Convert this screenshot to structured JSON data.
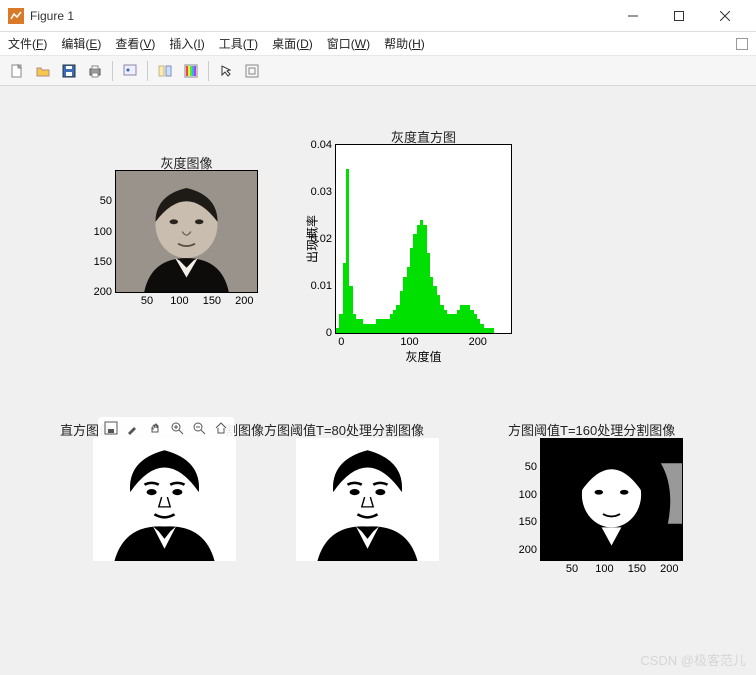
{
  "window": {
    "title": "Figure 1",
    "min_name": "minimize-icon",
    "max_name": "maximize-icon",
    "close_name": "close-icon"
  },
  "menu": {
    "file": "文件(F)",
    "edit": "编辑(E)",
    "view": "查看(V)",
    "insert": "插入(I)",
    "tools": "工具(T)",
    "desktop": "桌面(D)",
    "window": "窗口(W)",
    "help": "帮助(H)"
  },
  "toolbar": {
    "new": "new",
    "open": "open",
    "save": "save",
    "print": "print",
    "datacursor": "data-cursor",
    "link": "link",
    "colorbar": "colorbar",
    "legend": "legend",
    "arrow": "arrow",
    "editplot": "edit-plot"
  },
  "floating": {
    "save": "save",
    "brush": "brush",
    "hand": "hand",
    "zoomin": "zoom-in",
    "zoomout": "zoom-out",
    "home": "home"
  },
  "subplots": {
    "gray": {
      "title": "灰度图像",
      "yticks": [
        "50",
        "100",
        "150",
        "200"
      ],
      "xticks": [
        "50",
        "100",
        "150",
        "200"
      ]
    },
    "hist": {
      "title": "灰度直方图",
      "ylabel": "出现概率",
      "xlabel": "灰度值",
      "yticks": [
        "0",
        "0.01",
        "0.02",
        "0.03",
        "0.04"
      ],
      "xticks": [
        "0",
        "100",
        "200"
      ]
    },
    "row2": {
      "t1": "直方图像",
      "t2": "割图像方图阈值T=80处理分割图像",
      "t3": "方图阈值T=160处理分割图像",
      "yticks": [
        "50",
        "100",
        "150",
        "200"
      ],
      "xticks": [
        "50",
        "100",
        "150",
        "200"
      ]
    }
  },
  "chart_data": {
    "type": "bar",
    "title": "灰度直方图",
    "xlabel": "灰度值",
    "ylabel": "出现概率",
    "xlim": [
      0,
      255
    ],
    "ylim": [
      0,
      0.04
    ],
    "x": [
      0,
      5,
      10,
      15,
      20,
      25,
      30,
      35,
      40,
      45,
      50,
      55,
      60,
      65,
      70,
      75,
      80,
      85,
      90,
      95,
      100,
      105,
      110,
      115,
      120,
      125,
      130,
      135,
      140,
      145,
      150,
      155,
      160,
      165,
      170,
      175,
      180,
      185,
      190,
      195,
      200,
      205,
      210,
      215,
      220,
      225,
      230,
      235,
      240,
      245,
      250,
      255
    ],
    "values": [
      0.001,
      0.004,
      0.015,
      0.035,
      0.01,
      0.004,
      0.003,
      0.003,
      0.002,
      0.002,
      0.002,
      0.002,
      0.003,
      0.003,
      0.003,
      0.003,
      0.004,
      0.005,
      0.006,
      0.009,
      0.012,
      0.014,
      0.018,
      0.021,
      0.023,
      0.024,
      0.023,
      0.017,
      0.012,
      0.01,
      0.008,
      0.006,
      0.005,
      0.004,
      0.004,
      0.004,
      0.005,
      0.006,
      0.006,
      0.006,
      0.005,
      0.004,
      0.003,
      0.002,
      0.001,
      0.001,
      0.001,
      0.0,
      0.0,
      0.0,
      0.0,
      0.0
    ]
  },
  "watermark": "CSDN @极客范儿"
}
